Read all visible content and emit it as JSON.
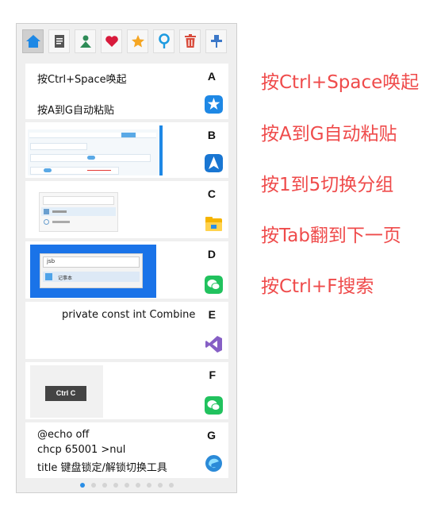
{
  "toolbar": {
    "items": [
      {
        "name": "home",
        "active": true
      },
      {
        "name": "document"
      },
      {
        "name": "person"
      },
      {
        "name": "heart"
      },
      {
        "name": "star"
      },
      {
        "name": "pin"
      },
      {
        "name": "trash"
      },
      {
        "name": "pushpin"
      }
    ]
  },
  "cards": [
    {
      "key": "A",
      "lines": [
        "按Ctrl+Space唤起",
        "按A到G自动粘贴"
      ],
      "icon": "star-chat-app-icon"
    },
    {
      "key": "B",
      "type": "image",
      "icon": "navigation-app-icon"
    },
    {
      "key": "C",
      "type": "image",
      "icon": "file-explorer-icon"
    },
    {
      "key": "D",
      "type": "image",
      "thumb_text": [
        "jsb",
        "记事本"
      ],
      "icon": "wechat-icon"
    },
    {
      "key": "E",
      "lines": [
        "private const int Combine"
      ],
      "icon": "visual-studio-icon"
    },
    {
      "key": "F",
      "type": "image",
      "thumb_text": [
        "Ctrl C"
      ],
      "icon": "wechat-icon"
    },
    {
      "key": "G",
      "lines": [
        "@echo off",
        "chcp 65001 >nul",
        "title 键盘锁定/解锁切换工具"
      ],
      "icon": "edge-icon"
    }
  ],
  "pagination": {
    "count": 9,
    "active": 0
  },
  "hints": [
    "按Ctrl+Space唤起",
    "按A到G自动粘贴",
    "按1到5切换分组",
    "按Tab翻到下一页",
    "按Ctrl+F搜索"
  ],
  "colors": {
    "accent": "#2a8ee6",
    "hint": "#ef4b4b"
  }
}
